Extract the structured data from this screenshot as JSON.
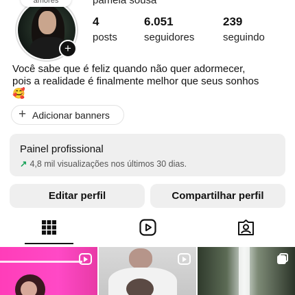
{
  "profile": {
    "name": "pamela sousa",
    "note": "amores",
    "stats": [
      {
        "value": "4",
        "label": "posts"
      },
      {
        "value": "6.051",
        "label": "seguidores"
      },
      {
        "value": "239",
        "label": "seguindo"
      }
    ],
    "bio_line1": "Você sabe que é feliz quando não quer adormecer,",
    "bio_line2": "pois a realidade é finalmente melhor que seus sonhos",
    "bio_emoji": "🥰"
  },
  "highlights": {
    "add_label": "Adicionar banners"
  },
  "professional_panel": {
    "title": "Painel profissional",
    "subtitle": "4,8 mil visualizações nos últimos 30 dias."
  },
  "actions": {
    "edit": "Editar perfil",
    "share": "Compartilhar perfil"
  },
  "tabs": [
    {
      "icon": "grid-icon",
      "active": true
    },
    {
      "icon": "reels-icon",
      "active": false
    },
    {
      "icon": "tagged-icon",
      "active": false
    }
  ],
  "posts": [
    {
      "kind": "reel"
    },
    {
      "kind": "reel"
    },
    {
      "kind": "carousel"
    }
  ],
  "colors": {
    "accent_green": "#1aa35a",
    "button_bg": "#efefef"
  }
}
